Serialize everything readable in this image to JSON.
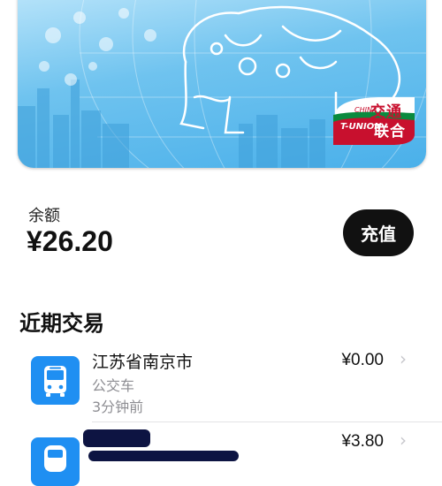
{
  "card": {
    "brand_cn_top": "交通",
    "brand_cn_bottom": "联合",
    "brand_en_top": "CHINA",
    "brand_en_bottom": "T-UNION",
    "accent_color": "#4ab0ea"
  },
  "balance": {
    "label": "余额",
    "amount": "¥26.20",
    "topup_label": "充值"
  },
  "recent": {
    "title": "近期交易",
    "transactions": [
      {
        "title": "江苏省南京市",
        "type": "公交车",
        "time": "3分钟前",
        "amount": "¥0.00",
        "icon": "bus-icon"
      },
      {
        "title": "",
        "type": "",
        "time": "",
        "amount": "¥3.80",
        "icon": "subway-icon"
      }
    ]
  },
  "chevron_glyph": "›"
}
